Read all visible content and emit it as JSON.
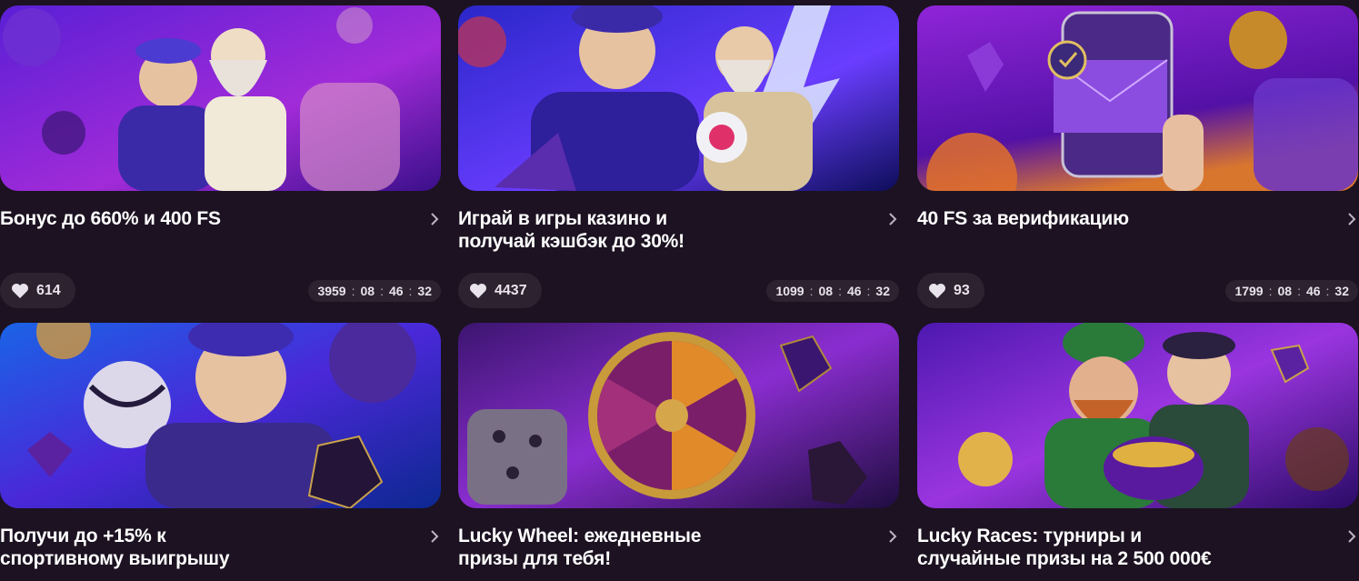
{
  "accent": "#7b2cff",
  "cards": [
    {
      "title": "Бонус до 660% и 400 FS",
      "likes": "614",
      "timer": [
        "3959",
        "08",
        "46",
        "32"
      ],
      "illustration": "zeus-and-boy-bitcoin",
      "colors": [
        "#5a1fd6",
        "#a12bd8",
        "#3a0f8a"
      ]
    },
    {
      "title": "Играй в игры казино и\nполучай кэшбэк до 30%!",
      "likes": "4437",
      "timer": [
        "1099",
        "08",
        "46",
        "32"
      ],
      "illustration": "zeus-lightning",
      "colors": [
        "#2a27c9",
        "#6a3dff",
        "#0d0e5a"
      ]
    },
    {
      "title": "40 FS за верификацию",
      "likes": "93",
      "timer": [
        "1799",
        "08",
        "46",
        "32"
      ],
      "illustration": "phone-envelope",
      "colors": [
        "#8f25d8",
        "#d9762e",
        "#5311a6"
      ]
    },
    {
      "title": "Получи до +15% к\nспортивному выигрышу",
      "illustration": "boy-football",
      "colors": [
        "#1a63e6",
        "#4a28d8",
        "#0c2890"
      ]
    },
    {
      "title": "Lucky Wheel: ежедневные\nпризы для тебя!",
      "illustration": "spin-wheel",
      "colors": [
        "#3c1570",
        "#8a2dd0",
        "#1f0d40"
      ]
    },
    {
      "title": "Lucky Races: турниры и\nслучайные призы на 2 500 000€",
      "illustration": "leprechaun-gold",
      "colors": [
        "#4d18b0",
        "#9a35e0",
        "#2a0b66"
      ]
    }
  ],
  "icons": {
    "like": "heart-icon",
    "more": "chevron-right-icon"
  }
}
